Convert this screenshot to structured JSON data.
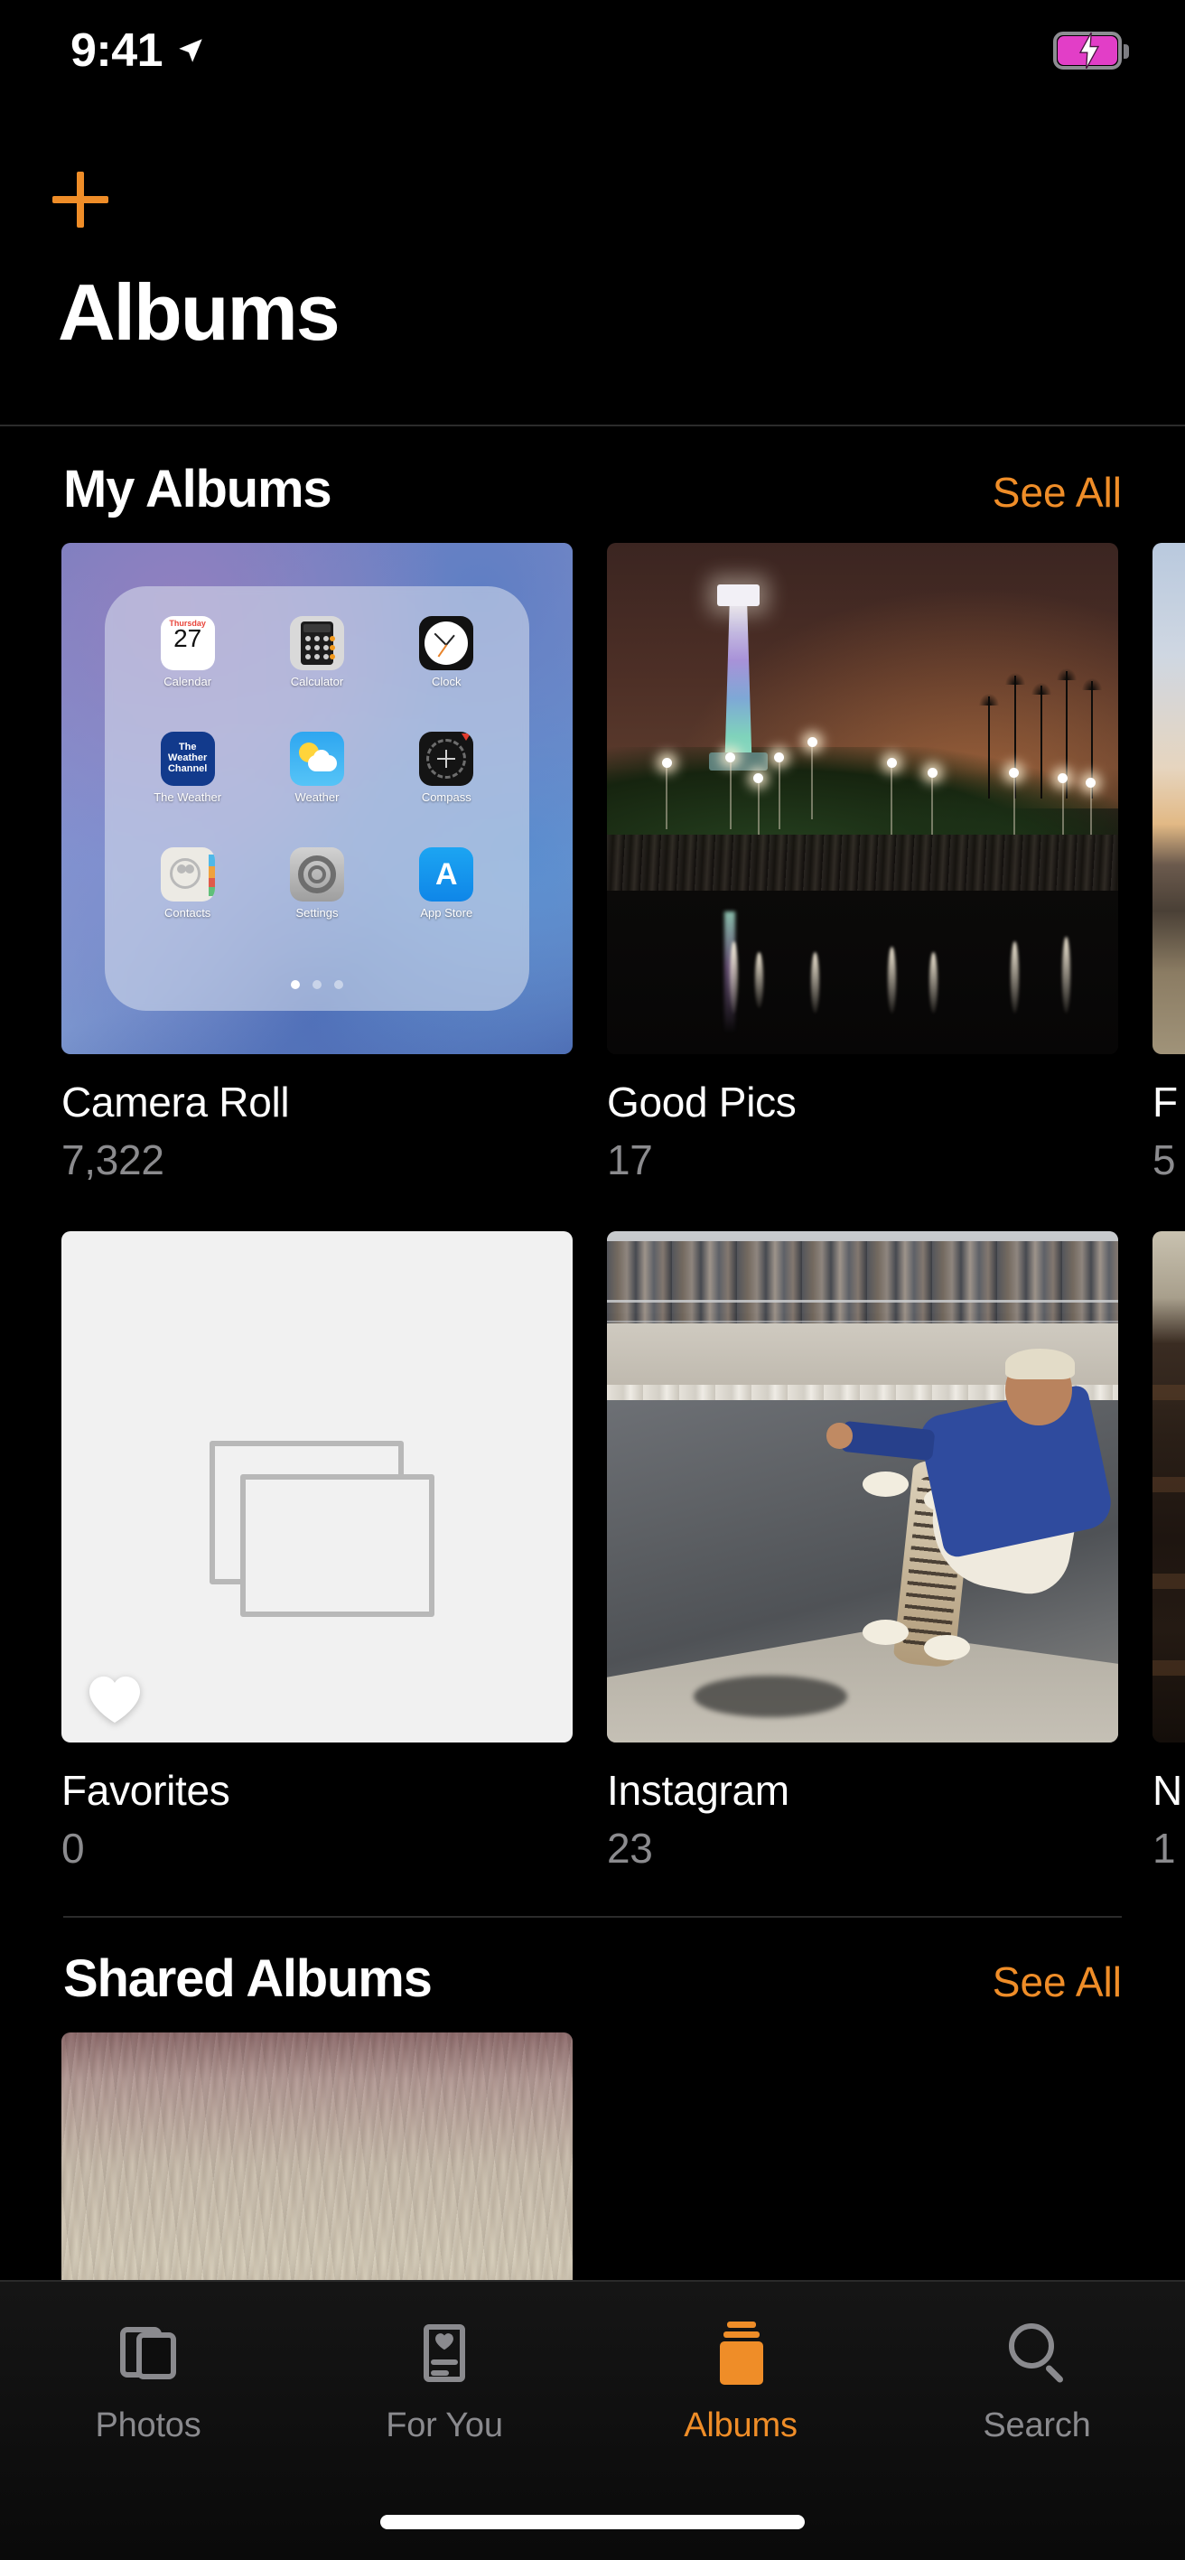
{
  "status_bar": {
    "time": "9:41",
    "location_icon": "location-arrow-icon",
    "battery_icon": "battery-charging-icon",
    "battery_color": "#e23ec7"
  },
  "nav": {
    "add_icon": "plus-icon",
    "title": "Albums",
    "accent_color": "#ef8d28"
  },
  "sections": [
    {
      "id": "my-albums",
      "title": "My Albums",
      "see_all_label": "See All",
      "albums": [
        {
          "title": "Camera Roll",
          "count": "7,322",
          "thumb": "ios-home-screen-folder-screenshot"
        },
        {
          "title": "Good Pics",
          "count": "17",
          "thumb": "lighthouse-at-night-photo"
        },
        {
          "title": "F",
          "count": "5",
          "thumb": "sunset-landscape-photo"
        },
        {
          "title": "Favorites",
          "count": "0",
          "thumb": "empty-album-placeholder"
        },
        {
          "title": "Instagram",
          "count": "23",
          "thumb": "skateboarder-in-bowl-photo"
        },
        {
          "title": "N",
          "count": "1",
          "thumb": "dark-interior-photo"
        }
      ]
    },
    {
      "id": "shared-albums",
      "title": "Shared Albums",
      "see_all_label": "See All",
      "albums": [
        {
          "title": "",
          "count": "",
          "thumb": "sandy-shoreline-photo"
        }
      ]
    }
  ],
  "camera_roll_thumb": {
    "apps": [
      {
        "name": "Calendar",
        "day": "Thursday",
        "date": "27"
      },
      {
        "name": "Calculator"
      },
      {
        "name": "Clock"
      },
      {
        "name": "The Weather",
        "logo_text": "The Weather Channel"
      },
      {
        "name": "Weather"
      },
      {
        "name": "Compass"
      },
      {
        "name": "Contacts"
      },
      {
        "name": "Settings"
      },
      {
        "name": "App Store",
        "glyph": "A"
      }
    ],
    "page_dots": 3,
    "active_dot": 1
  },
  "tab_bar": {
    "active": "Albums",
    "active_color": "#ef8d28",
    "inactive_color": "#8a8a8e",
    "tabs": [
      {
        "label": "Photos",
        "icon": "photos-stack-icon"
      },
      {
        "label": "For You",
        "icon": "for-you-card-heart-icon"
      },
      {
        "label": "Albums",
        "icon": "albums-stack-icon"
      },
      {
        "label": "Search",
        "icon": "magnifier-icon"
      }
    ]
  }
}
